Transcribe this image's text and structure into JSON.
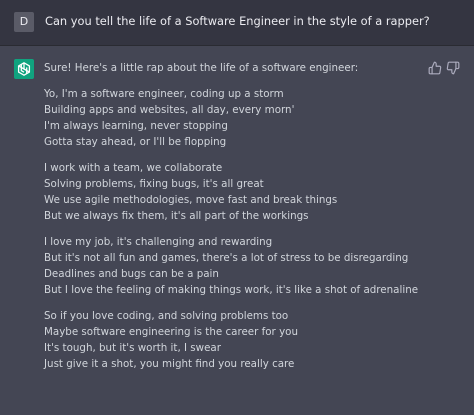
{
  "conversation": {
    "user": {
      "avatar_initial": "D",
      "message": "Can you tell the life of a Software Engineer in the style of a rapper?"
    },
    "assistant": {
      "intro": "Sure! Here's a little rap about the life of a software engineer:",
      "brand_color": "#10a37f",
      "stanzas": [
        [
          "Yo, I'm a software engineer, coding up a storm",
          "Building apps and websites, all day, every morn'",
          "I'm always learning, never stopping",
          "Gotta stay ahead, or I'll be flopping"
        ],
        [
          "I work with a team, we collaborate",
          "Solving problems, fixing bugs, it's all great",
          "We use agile methodologies, move fast and break things",
          "But we always fix them, it's all part of the workings"
        ],
        [
          "I love my job, it's challenging and rewarding",
          "But it's not all fun and games, there's a lot of stress to be disregarding",
          "Deadlines and bugs can be a pain",
          "But I love the feeling of making things work, it's like a shot of adrenaline"
        ],
        [
          "So if you love coding, and solving problems too",
          "Maybe software engineering is the career for you",
          "It's tough, but it's worth it, I swear",
          "Just give it a shot, you might find you really care"
        ]
      ]
    }
  },
  "icons": {
    "assistant_avatar": "openai-logo-icon",
    "thumbs_up": "thumbs-up-icon",
    "thumbs_down": "thumbs-down-icon"
  }
}
